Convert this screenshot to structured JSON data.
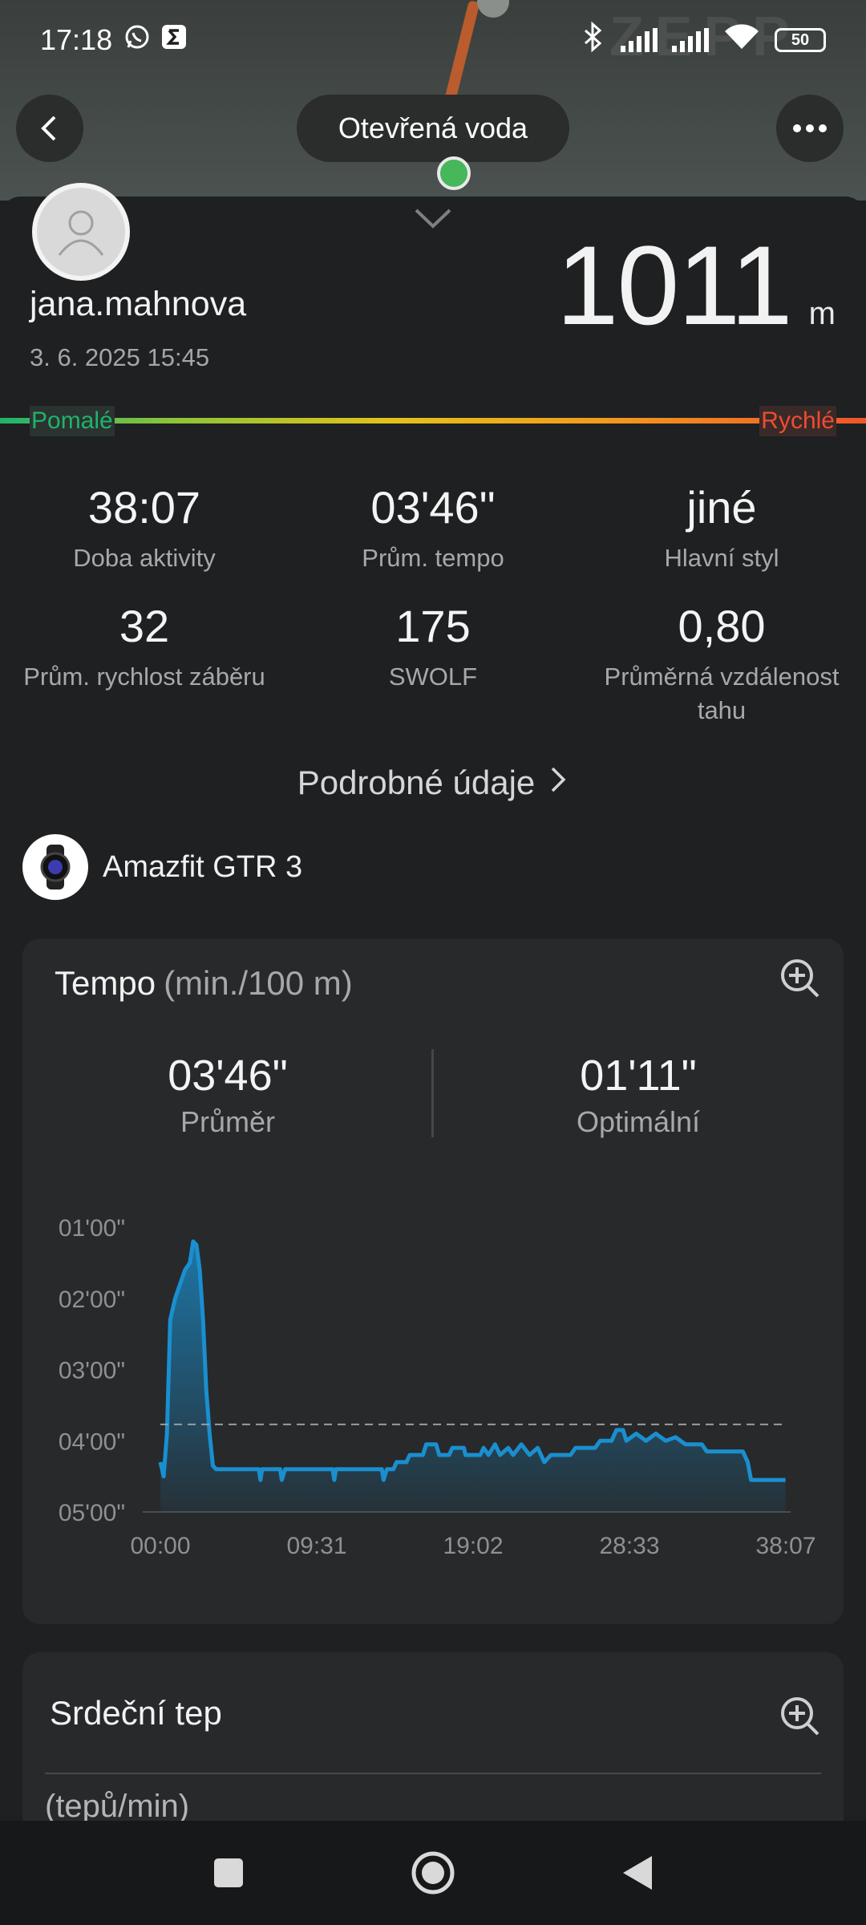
{
  "status_bar": {
    "time": "17:18",
    "battery": "50",
    "icons": [
      "whatsapp-icon",
      "sigma-icon",
      "bluetooth-icon",
      "signal-icon",
      "signal-icon",
      "wifi-icon",
      "battery-icon"
    ]
  },
  "header": {
    "title": "Otevřená voda",
    "back_icon": "back-arrow-icon",
    "more_icon": "more-dots-icon"
  },
  "profile": {
    "username": "jana.mahnova",
    "datetime": "3. 6. 2025 15:45",
    "distance_value": "1011",
    "distance_unit": "m"
  },
  "speed_scale": {
    "slow_label": "Pomalé",
    "fast_label": "Rychlé"
  },
  "stats": [
    {
      "value": "38:07",
      "label": "Doba aktivity"
    },
    {
      "value": "03'46\"",
      "label": "Prům. tempo"
    },
    {
      "value": "jiné",
      "label": "Hlavní styl"
    },
    {
      "value": "32",
      "label": "Prům. rychlost záběru"
    },
    {
      "value": "175",
      "label": "SWOLF"
    },
    {
      "value": "0,80",
      "label": "Průměrná vzdálenost tahu"
    }
  ],
  "details_link": "Podrobné údaje",
  "device": {
    "name": "Amazfit GTR 3"
  },
  "tempo_card": {
    "title": "Tempo",
    "unit": "(min./100 m)",
    "average_value": "03'46\"",
    "average_label": "Průměr",
    "optimal_value": "01'11\"",
    "optimal_label": "Optimální"
  },
  "chart_data": {
    "type": "area",
    "y_ticks": [
      "01'00\"",
      "02'00\"",
      "03'00\"",
      "04'00\"",
      "05'00\""
    ],
    "x_ticks": [
      "00:00",
      "09:31",
      "19:02",
      "28:33",
      "38:07"
    ],
    "y_axis": "pace min/100m (inverted, faster at top)",
    "ylim": [
      5.0,
      1.0
    ],
    "xlim": [
      0,
      38.12
    ],
    "average_line": 3.77,
    "color": "#1a8fcf",
    "points": [
      [
        0.0,
        4.3
      ],
      [
        0.2,
        4.5
      ],
      [
        0.4,
        3.9
      ],
      [
        0.6,
        2.3
      ],
      [
        0.9,
        2.0
      ],
      [
        1.2,
        1.8
      ],
      [
        1.5,
        1.6
      ],
      [
        1.8,
        1.5
      ],
      [
        2.0,
        1.2
      ],
      [
        2.2,
        1.25
      ],
      [
        2.4,
        1.6
      ],
      [
        2.6,
        2.3
      ],
      [
        2.8,
        3.3
      ],
      [
        3.0,
        3.9
      ],
      [
        3.2,
        4.35
      ],
      [
        3.4,
        4.4
      ],
      [
        6.0,
        4.4
      ],
      [
        6.1,
        4.55
      ],
      [
        6.2,
        4.4
      ],
      [
        7.3,
        4.4
      ],
      [
        7.4,
        4.55
      ],
      [
        7.6,
        4.4
      ],
      [
        10.5,
        4.4
      ],
      [
        10.6,
        4.55
      ],
      [
        10.7,
        4.4
      ],
      [
        13.5,
        4.4
      ],
      [
        13.6,
        4.55
      ],
      [
        13.8,
        4.4
      ],
      [
        14.2,
        4.4
      ],
      [
        14.4,
        4.3
      ],
      [
        15.0,
        4.3
      ],
      [
        15.2,
        4.2
      ],
      [
        16.0,
        4.2
      ],
      [
        16.2,
        4.05
      ],
      [
        16.8,
        4.05
      ],
      [
        17.0,
        4.2
      ],
      [
        17.6,
        4.2
      ],
      [
        17.8,
        4.1
      ],
      [
        18.5,
        4.1
      ],
      [
        18.6,
        4.2
      ],
      [
        19.5,
        4.2
      ],
      [
        19.7,
        4.1
      ],
      [
        20.0,
        4.2
      ],
      [
        20.4,
        4.05
      ],
      [
        20.7,
        4.2
      ],
      [
        21.2,
        4.1
      ],
      [
        21.5,
        4.2
      ],
      [
        22.0,
        4.05
      ],
      [
        22.5,
        4.2
      ],
      [
        23.0,
        4.1
      ],
      [
        23.4,
        4.3
      ],
      [
        23.8,
        4.2
      ],
      [
        25.0,
        4.2
      ],
      [
        25.3,
        4.1
      ],
      [
        26.5,
        4.1
      ],
      [
        26.8,
        4.0
      ],
      [
        27.5,
        4.0
      ],
      [
        27.8,
        3.85
      ],
      [
        28.2,
        3.85
      ],
      [
        28.4,
        4.0
      ],
      [
        29.0,
        3.9
      ],
      [
        29.6,
        4.0
      ],
      [
        30.2,
        3.9
      ],
      [
        30.8,
        4.0
      ],
      [
        31.4,
        3.95
      ],
      [
        32.0,
        4.05
      ],
      [
        33.0,
        4.05
      ],
      [
        33.3,
        4.15
      ],
      [
        35.5,
        4.15
      ],
      [
        35.8,
        4.3
      ],
      [
        36.0,
        4.55
      ],
      [
        38.1,
        4.55
      ]
    ]
  },
  "hr_card": {
    "title": "Srdeční tep",
    "unit": "(tepů/min)"
  },
  "bottom_nav": [
    "recents-icon",
    "home-icon",
    "back-icon"
  ]
}
